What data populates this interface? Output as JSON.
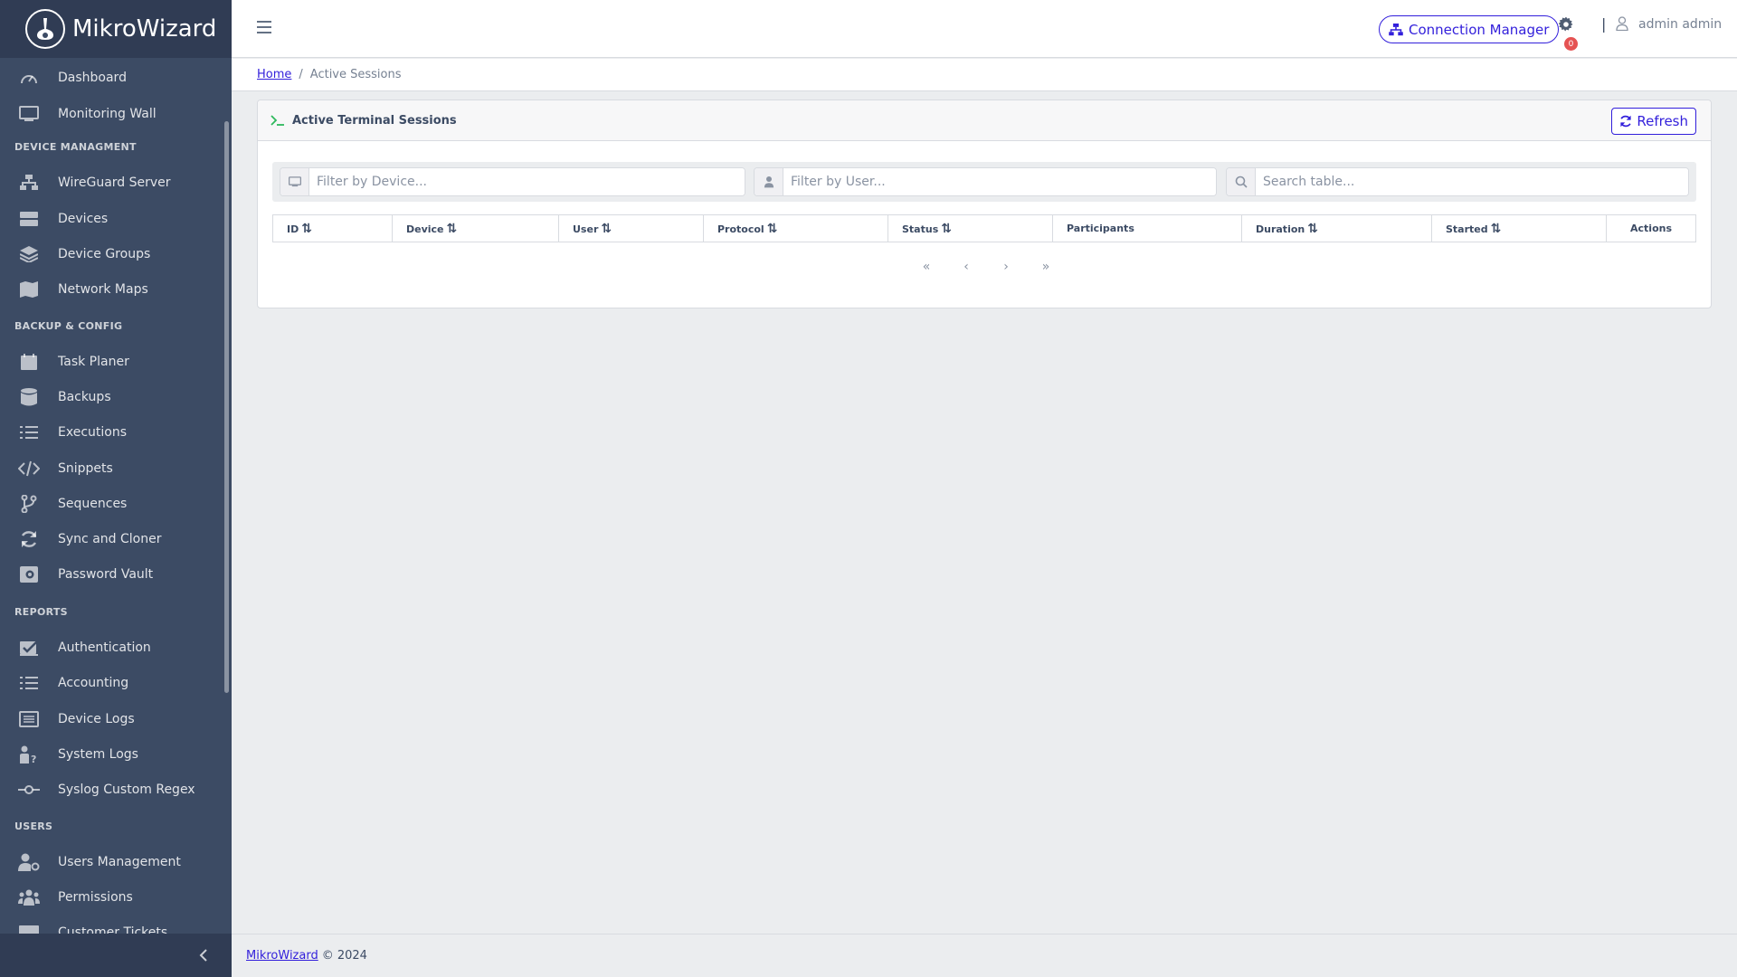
{
  "brand": {
    "name": "MikroWizard"
  },
  "colors": {
    "sidebar": "#3c4b64",
    "primary": "#321fdb",
    "badge": "#e55353",
    "terminal_icon": "#2eb85c"
  },
  "sidebar": {
    "items_top": [
      {
        "label": "Dashboard",
        "icon": "speedometer-icon"
      },
      {
        "label": "Monitoring Wall",
        "icon": "monitor-icon"
      }
    ],
    "section_device": "DEVICE MANAGMENT",
    "items_device": [
      {
        "label": "WireGuard Server",
        "icon": "network-icon"
      },
      {
        "label": "Devices",
        "icon": "storage-icon"
      },
      {
        "label": "Device Groups",
        "icon": "layers-icon"
      },
      {
        "label": "Network Maps",
        "icon": "map-icon"
      }
    ],
    "section_backup": "BACKUP & CONFIG",
    "items_backup": [
      {
        "label": "Task Planer",
        "icon": "calendar-icon"
      },
      {
        "label": "Backups",
        "icon": "database-icon"
      },
      {
        "label": "Executions",
        "icon": "list-icon"
      },
      {
        "label": "Snippets",
        "icon": "code-icon"
      },
      {
        "label": "Sequences",
        "icon": "branch-icon"
      },
      {
        "label": "Sync and Cloner",
        "icon": "sync-icon"
      },
      {
        "label": "Password Vault",
        "icon": "vault-icon"
      }
    ],
    "section_reports": "REPORTS",
    "items_reports": [
      {
        "label": "Authentication",
        "icon": "check-square-icon"
      },
      {
        "label": "Accounting",
        "icon": "list-check-icon"
      },
      {
        "label": "Device Logs",
        "icon": "log-list-icon"
      },
      {
        "label": "System Logs",
        "icon": "user-question-icon"
      },
      {
        "label": "Syslog Custom Regex",
        "icon": "commit-icon"
      }
    ],
    "section_users": "USERS",
    "items_users": [
      {
        "label": "Users Management",
        "icon": "user-gear-icon"
      },
      {
        "label": "Permissions",
        "icon": "people-icon"
      },
      {
        "label": "Customer Tickets",
        "icon": "ticket-icon"
      }
    ]
  },
  "header": {
    "connection_manager": "Connection Manager",
    "notification_count": "0",
    "separator": "|",
    "user": "admin admin"
  },
  "breadcrumb": {
    "home": "Home",
    "separator": "/",
    "current": "Active Sessions"
  },
  "card": {
    "title": "Active Terminal Sessions",
    "refresh": "Refresh",
    "filters": {
      "device_placeholder": "Filter by Device...",
      "user_placeholder": "Filter by User...",
      "search_placeholder": "Search table..."
    },
    "columns": [
      "ID",
      "Device",
      "User",
      "Protocol",
      "Status",
      "Participants",
      "Duration",
      "Started",
      "Actions"
    ],
    "sort_glyph": "⇅",
    "pager": {
      "first": "«",
      "prev": "‹",
      "next": "›",
      "last": "»"
    }
  },
  "footer": {
    "link": "MikroWizard",
    "text": "© 2024"
  }
}
